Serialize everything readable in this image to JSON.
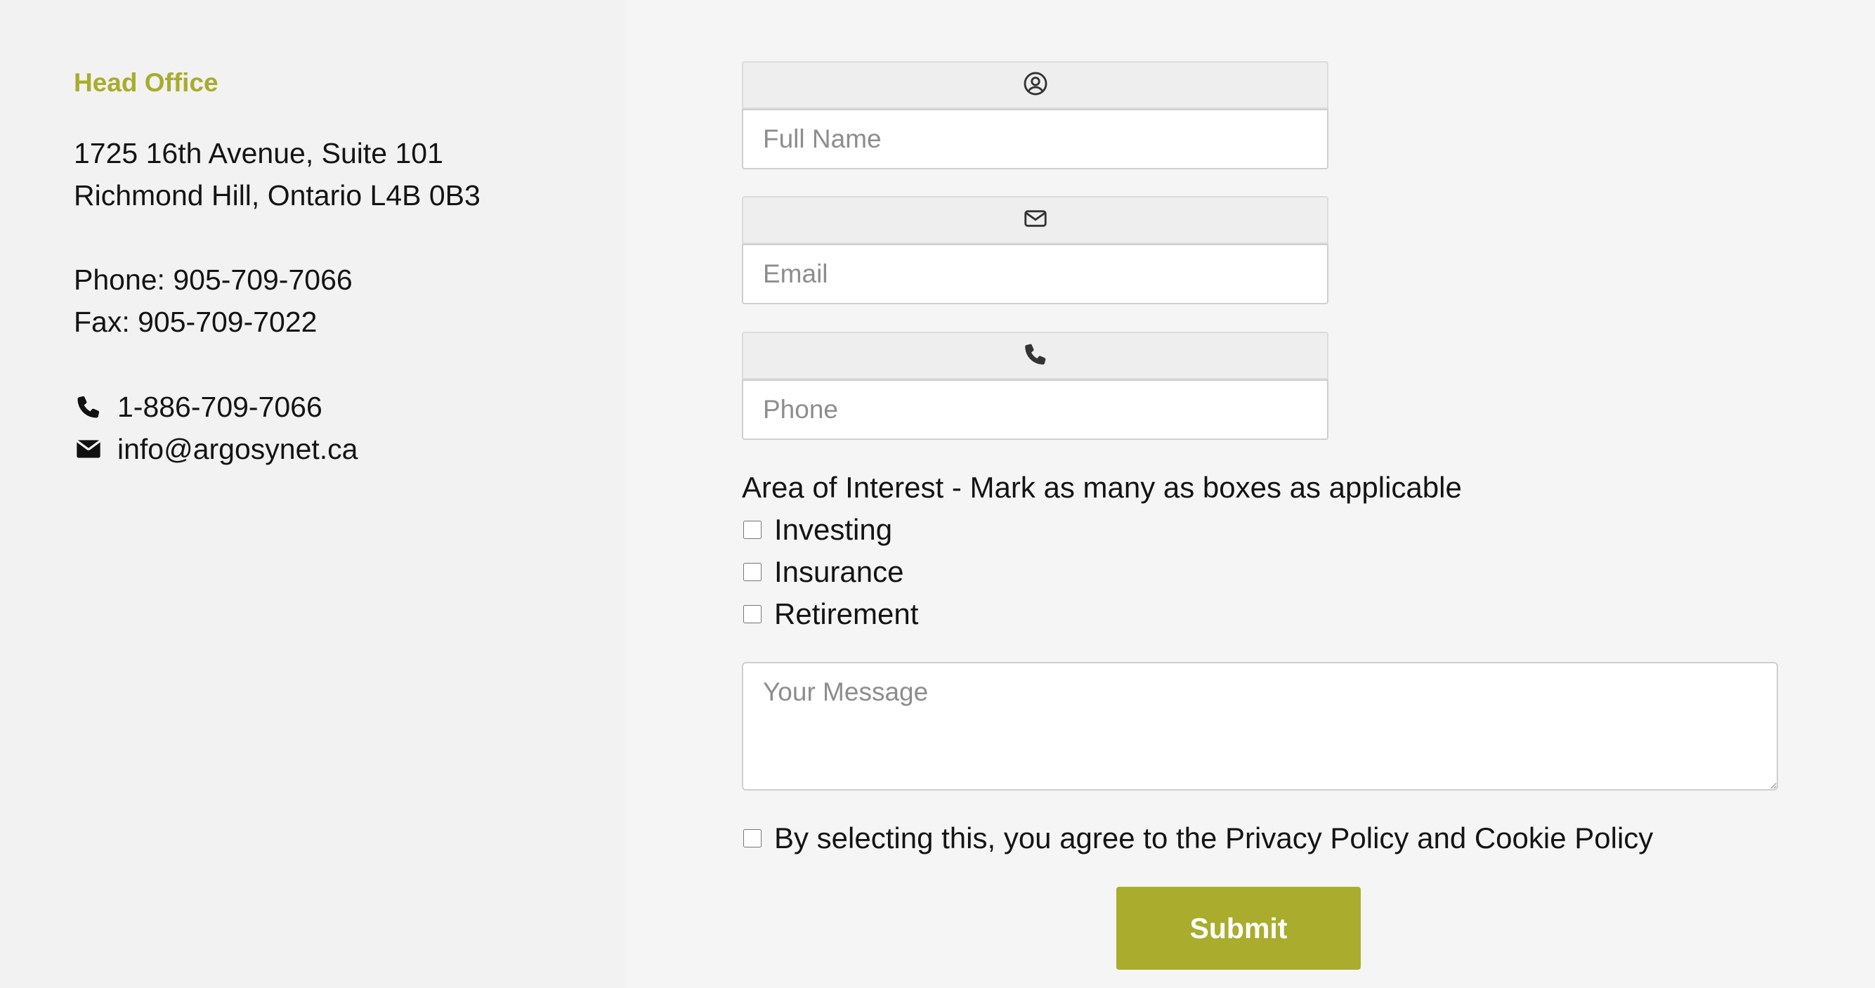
{
  "contact": {
    "title": "Head Office",
    "address_line1": "1725 16th Avenue, Suite 101",
    "address_line2": "Richmond Hill, Ontario L4B 0B3",
    "phone": "Phone: 905-709-7066",
    "fax": "Fax: 905-709-7022",
    "tollfree": "1-886-709-7066",
    "email": "info@argosynet.ca",
    "tollfree_icon": "phone-icon",
    "email_icon": "envelope-icon"
  },
  "form": {
    "name": {
      "icon": "user-circle-icon",
      "placeholder": "Full Name",
      "value": ""
    },
    "email": {
      "icon": "envelope-icon",
      "placeholder": "Email",
      "value": ""
    },
    "phone": {
      "icon": "phone-icon",
      "placeholder": "Phone",
      "value": ""
    },
    "interest_label": "Area of Interest - Mark as many as boxes as applicable",
    "interests": [
      {
        "label": "Investing",
        "checked": false
      },
      {
        "label": "Insurance",
        "checked": false
      },
      {
        "label": "Retirement",
        "checked": false
      }
    ],
    "message": {
      "placeholder": "Your Message",
      "value": ""
    },
    "consent": {
      "label": "By selecting this, you agree to the Privacy Policy and Cookie Policy",
      "checked": false
    },
    "submit_label": "Submit"
  },
  "colors": {
    "accent": "#a9ac2c",
    "left_panel_bg": "#f2f2f2",
    "right_panel_bg": "#f5f5f5",
    "icon_bar_bg": "#eeeeee"
  }
}
